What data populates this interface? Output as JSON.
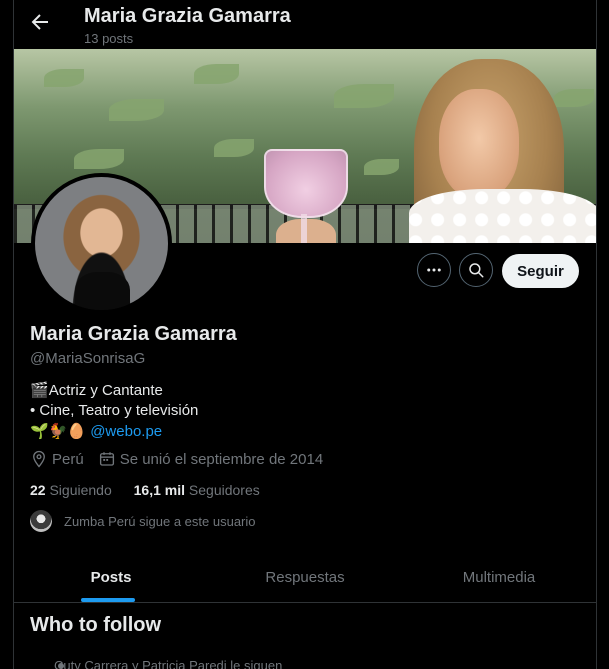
{
  "header": {
    "title": "Maria Grazia Gamarra",
    "post_count": "13 posts"
  },
  "actions": {
    "follow_label": "Seguir"
  },
  "profile": {
    "name": "Maria Grazia Gamarra",
    "handle": "@MariaSonrisaG",
    "bio_line1_emoji": "🎬",
    "bio_line1_text": "Actriz y Cantante",
    "bio_line2": "• Cine, Teatro y televisión",
    "bio_line3_emoji": "🌱🐓🥚",
    "bio_link_handle": "@webo",
    "bio_link_suffix": ".pe",
    "location": "Perú",
    "joined": "Se unió el septiembre de 2014",
    "following_count": "22",
    "following_label": "Siguiendo",
    "followers_count": "16,1 mil",
    "followers_label": "Seguidores",
    "followed_by": "Zumba Perú sigue a este usuario"
  },
  "tabs": [
    {
      "label": "Posts",
      "active": true
    },
    {
      "label": "Respuestas",
      "active": false
    },
    {
      "label": "Multimedia",
      "active": false
    }
  ],
  "who_to_follow": {
    "title": "Who to follow",
    "first_item_context": "Cuty Carrera y Patricia Paredi le siguen"
  },
  "colors": {
    "background": "#000000",
    "accent": "#1d9bf0",
    "secondary_text": "#71767b",
    "primary_text": "#e7e9ea",
    "follow_button_bg": "#eff3f4"
  },
  "icons": [
    "back-arrow-icon",
    "more-icon",
    "search-icon",
    "location-icon",
    "calendar-icon"
  ]
}
